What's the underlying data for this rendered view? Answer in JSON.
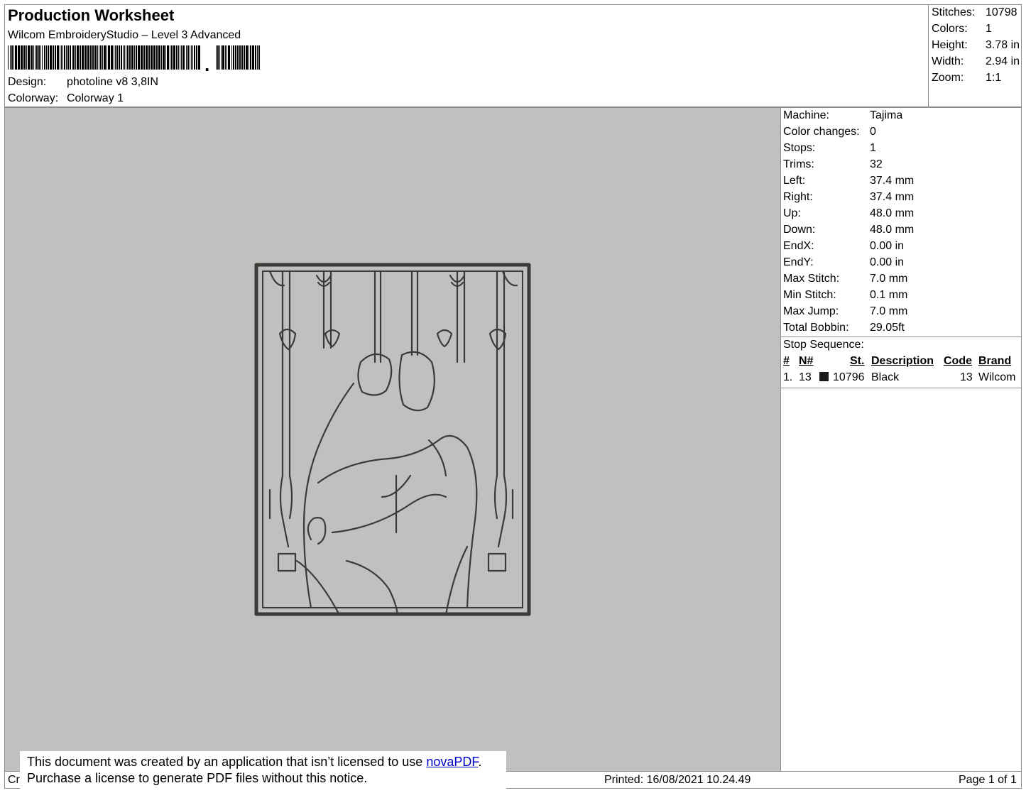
{
  "header": {
    "title": "Production Worksheet",
    "subtitle": "Wilcom EmbroideryStudio – Level 3 Advanced",
    "design_label": "Design:",
    "design_value": "photoline v8 3,8IN",
    "colorway_label": "Colorway:",
    "colorway_value": "Colorway 1"
  },
  "stats": [
    {
      "label": "Stitches:",
      "value": "10798"
    },
    {
      "label": "Colors:",
      "value": "1"
    },
    {
      "label": "Height:",
      "value": "3.78 in"
    },
    {
      "label": "Width:",
      "value": "2.94 in"
    },
    {
      "label": "Zoom:",
      "value": "1:1"
    }
  ],
  "machine_info": [
    {
      "label": "Machine:",
      "value": "Tajima"
    },
    {
      "label": "Color changes:",
      "value": "0"
    },
    {
      "label": "Stops:",
      "value": "1"
    },
    {
      "label": "Trims:",
      "value": "32"
    },
    {
      "label": "Left:",
      "value": "37.4 mm"
    },
    {
      "label": "Right:",
      "value": "37.4 mm"
    },
    {
      "label": "Up:",
      "value": "48.0 mm"
    },
    {
      "label": "Down:",
      "value": "48.0 mm"
    },
    {
      "label": "EndX:",
      "value": "0.00 in"
    },
    {
      "label": "EndY:",
      "value": "0.00 in"
    },
    {
      "label": "Max Stitch:",
      "value": "7.0 mm"
    },
    {
      "label": "Min Stitch:",
      "value": "0.1 mm"
    },
    {
      "label": "Max Jump:",
      "value": "7.0 mm"
    },
    {
      "label": "Total Bobbin:",
      "value": "29.05ft"
    }
  ],
  "stop_sequence": {
    "title": "Stop Sequence:",
    "columns": {
      "num": "#",
      "n": "N#",
      "st": "St.",
      "desc": "Description",
      "code": "Code",
      "brand": "Brand"
    },
    "rows": [
      {
        "num": "1.",
        "n": "13",
        "color": "#1a1a1a",
        "st": "10796",
        "desc": "Black",
        "code": "13",
        "brand": "Wilcom"
      }
    ]
  },
  "footer": {
    "left_fragment": "Cr",
    "printed": "Printed: 16/08/2021 10.24.49",
    "page": "Page 1 of 1"
  },
  "notice": {
    "line1_prefix": "This document was created by an application that isn’t licensed to use ",
    "link": "novaPDF",
    "line1_suffix": ".",
    "line2": "Purchase a license to generate PDF files without this notice."
  },
  "colors": {
    "thread": "#3a3a36",
    "canvas_bg": "#c0c0c0",
    "border": "#8c8c8c"
  }
}
